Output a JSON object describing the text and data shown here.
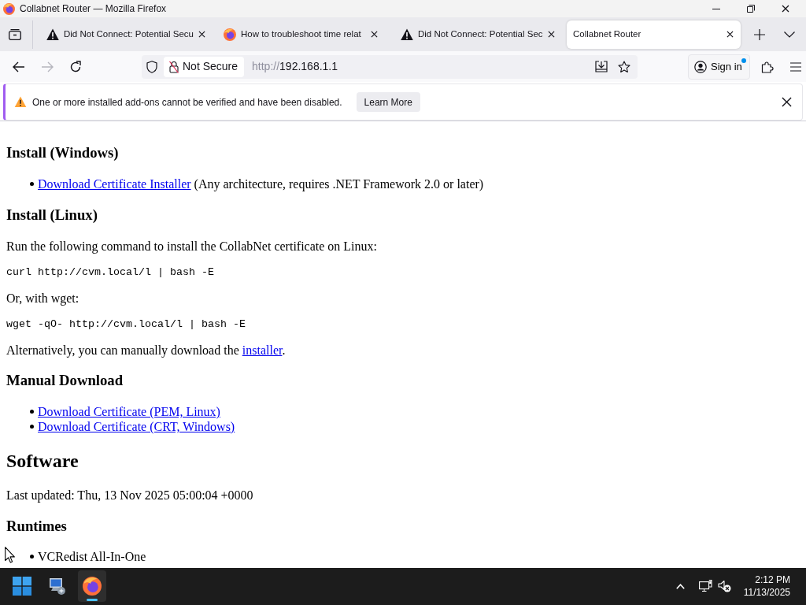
{
  "window": {
    "title": "Collabnet Router — Mozilla Firefox"
  },
  "tabs": [
    {
      "kind": "warning",
      "label": "Did Not Connect: Potential Secu",
      "selected": false
    },
    {
      "kind": "firefox",
      "label": "How to troubleshoot time relat",
      "selected": false
    },
    {
      "kind": "warning",
      "label": "Did Not Connect: Potential Sec",
      "selected": false
    },
    {
      "kind": "plain",
      "label": "Collabnet Router",
      "selected": true
    }
  ],
  "nav_buttons": [
    {
      "kind": "back",
      "disabled": false
    },
    {
      "kind": "forward",
      "disabled": true
    },
    {
      "kind": "reload",
      "disabled": false
    }
  ],
  "address_bar": {
    "security": "Not Secure",
    "scheme": "http://",
    "host": "192.168.1.1"
  },
  "account": {
    "label": "Sign in",
    "notification": true
  },
  "notification_bar": {
    "message": "One or more installed add-ons cannot be verified and have been disabled.",
    "button": "Learn More"
  },
  "page": {
    "blocks": [
      {
        "kind": "heading3",
        "text": "Install (Windows)"
      },
      {
        "kind": "list",
        "items": [
          {
            "link": "Download Certificate Installer",
            "text": "(Any architecture, requires .NET Framework 2.0 or later)"
          }
        ]
      },
      {
        "kind": "heading3",
        "text": "Install (Linux)"
      },
      {
        "kind": "paragraph",
        "text": "Run the following command to install the CollabNet certificate on Linux:"
      },
      {
        "kind": "code",
        "text": "curl http://cvm.local/l | bash -E"
      },
      {
        "kind": "paragraph",
        "text": "Or, with wget:"
      },
      {
        "kind": "code",
        "text": "wget -qO- http://cvm.local/l | bash -E"
      },
      {
        "kind": "paragraph",
        "text": "Alternatively, you can manually download the",
        "link": "installer",
        "after": "."
      },
      {
        "kind": "heading3",
        "text": "Manual Download"
      },
      {
        "kind": "list",
        "items": [
          {
            "link": "Download Certificate (PEM, Linux)"
          },
          {
            "link": "Download Certificate (CRT, Windows)"
          }
        ]
      },
      {
        "kind": "heading2",
        "text": "Software"
      },
      {
        "kind": "paragraph",
        "text": "Last updated: Thu, 13 Nov 2025 05:00:04 +0000"
      },
      {
        "kind": "heading3",
        "text": "Runtimes"
      },
      {
        "kind": "list",
        "items": [
          {
            "text": "VCRedist All-In-One"
          }
        ]
      }
    ]
  },
  "taskbar": {
    "apps": [
      {
        "kind": "start",
        "active": false
      },
      {
        "kind": "remote",
        "active": false
      },
      {
        "kind": "firefox",
        "active": true
      }
    ],
    "time": "2:12 PM",
    "date": "11/13/2025"
  }
}
